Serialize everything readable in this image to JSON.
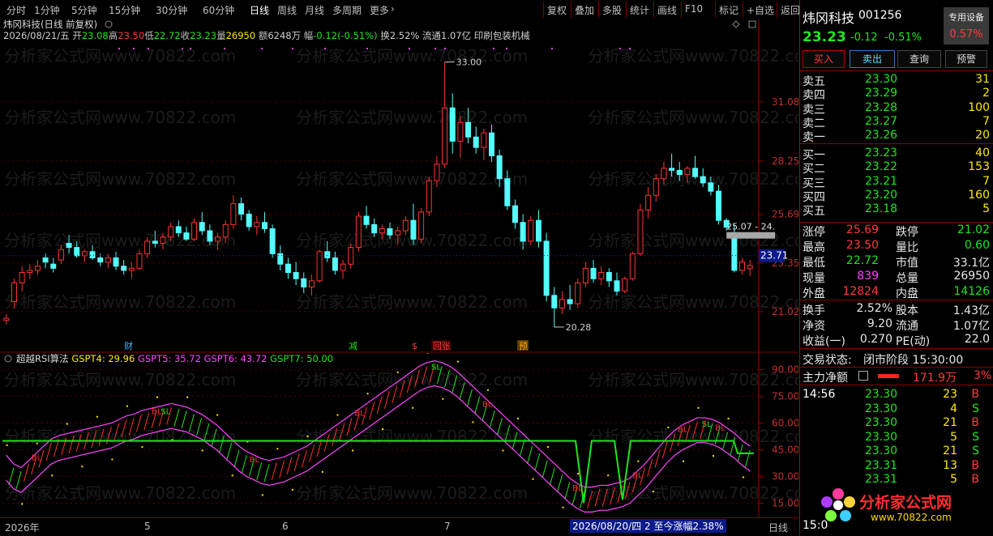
{
  "toolbar": {
    "periods": [
      "分时",
      "1分钟",
      "5分钟",
      "15分钟",
      "30分钟",
      "60分钟",
      "日线",
      "周线",
      "月线",
      "多周期",
      "更多"
    ],
    "active_period": "日线",
    "more_chevron": "›",
    "actions": [
      "复权",
      "叠加",
      "多股",
      "统计",
      "画线",
      "F10",
      "标记",
      "+自选",
      "返回"
    ]
  },
  "info_line": {
    "date": "2026/08/21/五",
    "open_label": "开",
    "open": "23.08",
    "high_label": "高",
    "high": "23.50",
    "low_label": "低",
    "low": "22.72",
    "close_label": "收",
    "close": "23.23",
    "vol_label": "量",
    "vol": "26950",
    "amt_label": "额",
    "amt": "6248万",
    "chg_label": "幅",
    "chg": "-0.12(-0.51%)",
    "turnover": "换2.52%",
    "float": "流通1.07亿",
    "industry": "印刷包装机械"
  },
  "chart_title": "炜冈科技(日线 前复权)",
  "watermark": "分析家公式网www.70822.com",
  "chart_data": [
    {
      "type": "candlestick",
      "y_ticks": [
        "31.08",
        "28.25",
        "25.69",
        "23.35",
        "21.02"
      ],
      "ylim": [
        19.5,
        34.5
      ],
      "current_price_label": "23.71",
      "peak_label": "33.00",
      "trough_label": "20.28",
      "range_label": "25.07 - 24.",
      "event_markers": [
        "财",
        "减",
        "$",
        "回张",
        "预"
      ],
      "candles": [
        [
          20.6,
          20.9,
          20.4,
          20.7
        ],
        [
          21.5,
          22.6,
          21.2,
          22.4
        ],
        [
          22.4,
          23.2,
          22.0,
          22.9
        ],
        [
          22.9,
          23.3,
          22.6,
          23.0
        ],
        [
          23.0,
          23.5,
          22.8,
          23.2
        ],
        [
          23.6,
          23.8,
          23.1,
          23.4
        ],
        [
          23.3,
          23.6,
          22.9,
          23.1
        ],
        [
          23.5,
          24.2,
          23.3,
          24.0
        ],
        [
          24.3,
          24.7,
          23.8,
          24.1
        ],
        [
          24.1,
          24.4,
          23.6,
          23.7
        ],
        [
          23.7,
          24.0,
          23.4,
          23.9
        ],
        [
          23.9,
          24.2,
          23.5,
          23.6
        ],
        [
          23.6,
          23.8,
          23.2,
          23.4
        ],
        [
          23.4,
          23.8,
          23.1,
          23.6
        ],
        [
          23.6,
          23.9,
          23.0,
          23.2
        ],
        [
          23.2,
          23.5,
          22.8,
          23.0
        ],
        [
          23.0,
          23.4,
          22.6,
          23.1
        ],
        [
          23.1,
          24.0,
          23.0,
          23.8
        ],
        [
          23.8,
          24.6,
          23.6,
          24.4
        ],
        [
          24.4,
          24.9,
          24.1,
          24.3
        ],
        [
          24.3,
          24.8,
          24.0,
          24.6
        ],
        [
          24.6,
          25.3,
          24.4,
          25.1
        ],
        [
          25.1,
          25.4,
          24.6,
          24.8
        ],
        [
          24.8,
          25.1,
          24.4,
          24.5
        ],
        [
          24.5,
          25.5,
          24.4,
          25.3
        ],
        [
          25.3,
          25.8,
          24.7,
          24.9
        ],
        [
          24.9,
          25.2,
          24.2,
          24.4
        ],
        [
          24.4,
          24.8,
          24.0,
          24.6
        ],
        [
          24.6,
          25.4,
          24.3,
          25.2
        ],
        [
          25.2,
          26.6,
          25.0,
          26.2
        ],
        [
          26.2,
          26.5,
          25.4,
          25.7
        ],
        [
          25.7,
          25.9,
          24.9,
          25.1
        ],
        [
          25.1,
          25.6,
          24.7,
          25.3
        ],
        [
          25.3,
          25.8,
          24.8,
          25.0
        ],
        [
          25.0,
          25.2,
          23.6,
          23.8
        ],
        [
          23.8,
          24.2,
          23.0,
          23.3
        ],
        [
          23.3,
          23.6,
          22.6,
          22.9
        ],
        [
          22.9,
          23.4,
          22.3,
          22.6
        ],
        [
          22.6,
          22.9,
          21.9,
          22.2
        ],
        [
          22.2,
          22.8,
          21.8,
          22.5
        ],
        [
          22.5,
          24.0,
          22.4,
          23.9
        ],
        [
          23.9,
          24.4,
          23.4,
          23.6
        ],
        [
          23.6,
          23.9,
          22.8,
          23.0
        ],
        [
          23.0,
          23.5,
          22.6,
          23.3
        ],
        [
          23.3,
          24.3,
          23.1,
          24.1
        ],
        [
          24.1,
          25.8,
          23.9,
          25.6
        ],
        [
          25.6,
          26.1,
          25.0,
          25.2
        ],
        [
          25.2,
          25.5,
          24.6,
          24.8
        ],
        [
          24.8,
          25.2,
          24.5,
          25.0
        ],
        [
          25.0,
          25.3,
          24.5,
          24.7
        ],
        [
          24.7,
          25.1,
          24.3,
          24.9
        ],
        [
          24.9,
          25.6,
          24.7,
          25.4
        ],
        [
          25.4,
          26.2,
          24.2,
          24.5
        ],
        [
          24.5,
          26.0,
          24.3,
          25.8
        ],
        [
          25.8,
          27.5,
          25.6,
          27.3
        ],
        [
          27.3,
          28.5,
          27.0,
          28.1
        ],
        [
          28.1,
          33.0,
          27.9,
          30.8
        ],
        [
          30.8,
          31.5,
          28.6,
          29.2
        ],
        [
          29.2,
          30.4,
          28.4,
          30.1
        ],
        [
          30.1,
          30.8,
          29.1,
          29.4
        ],
        [
          29.4,
          29.9,
          28.6,
          28.9
        ],
        [
          28.9,
          29.8,
          28.3,
          29.6
        ],
        [
          29.6,
          30.0,
          28.2,
          28.5
        ],
        [
          28.5,
          28.8,
          27.0,
          27.4
        ],
        [
          27.4,
          27.8,
          25.9,
          26.1
        ],
        [
          26.1,
          26.4,
          25.0,
          25.3
        ],
        [
          25.3,
          25.7,
          24.0,
          24.4
        ],
        [
          24.4,
          25.6,
          24.2,
          25.4
        ],
        [
          25.4,
          25.9,
          24.1,
          24.4
        ],
        [
          24.4,
          24.8,
          21.5,
          21.8
        ],
        [
          21.8,
          22.2,
          20.28,
          21.2
        ],
        [
          21.2,
          22.0,
          20.9,
          21.6
        ],
        [
          21.6,
          22.3,
          21.1,
          21.4
        ],
        [
          21.4,
          22.6,
          21.2,
          22.4
        ],
        [
          22.4,
          23.4,
          22.2,
          23.1
        ],
        [
          23.1,
          23.5,
          22.4,
          22.6
        ],
        [
          22.6,
          23.2,
          22.3,
          22.9
        ],
        [
          22.9,
          23.1,
          22.2,
          22.5
        ],
        [
          22.5,
          22.9,
          21.8,
          22.0
        ],
        [
          22.0,
          22.7,
          21.9,
          22.6
        ],
        [
          22.6,
          23.9,
          22.5,
          23.8
        ],
        [
          23.8,
          26.2,
          23.7,
          25.9
        ],
        [
          25.9,
          27.0,
          25.5,
          26.6
        ],
        [
          26.6,
          27.6,
          26.3,
          27.4
        ],
        [
          27.4,
          28.2,
          27.1,
          27.9
        ],
        [
          27.9,
          28.6,
          27.5,
          27.8
        ],
        [
          27.8,
          28.2,
          27.3,
          27.6
        ],
        [
          27.6,
          28.0,
          27.2,
          27.9
        ],
        [
          27.9,
          28.5,
          27.4,
          27.5
        ],
        [
          27.5,
          27.9,
          27.0,
          27.2
        ],
        [
          27.2,
          27.5,
          26.6,
          26.8
        ],
        [
          26.8,
          27.1,
          25.2,
          25.4
        ],
        [
          25.4,
          25.5,
          24.9,
          25.07
        ],
        [
          24.8,
          25.2,
          22.9,
          23.0
        ],
        [
          23.0,
          23.6,
          22.8,
          23.4
        ],
        [
          23.08,
          23.5,
          22.72,
          23.23
        ]
      ]
    },
    {
      "type": "line",
      "title": "超越RSI算法",
      "series": [
        {
          "name": "GSPT4",
          "value": "29.96",
          "color": "#ffea00"
        },
        {
          "name": "GSPT5",
          "value": "35.72",
          "color": "#ff44ff"
        },
        {
          "name": "GSPT6",
          "value": "43.72",
          "color": "#ff44ff"
        },
        {
          "name": "GSPT7",
          "value": "50.00",
          "color": "#1ee61e"
        }
      ],
      "y_ticks": [
        "90.00",
        "75.00",
        "60.00",
        "45.00",
        "30.00",
        "15.00"
      ],
      "ylim": [
        12,
        93
      ],
      "line_value": [
        35,
        30,
        28,
        32,
        36,
        40,
        44,
        46,
        47,
        48,
        49,
        50,
        51,
        52,
        53,
        55,
        57,
        58,
        60,
        61,
        62,
        63,
        64,
        63,
        62,
        60,
        58,
        55,
        52,
        48,
        44,
        40,
        37,
        35,
        33,
        32,
        33,
        34,
        36,
        38,
        40,
        43,
        46,
        49,
        52,
        55,
        58,
        61,
        64,
        67,
        70,
        73,
        76,
        79,
        82,
        85,
        87,
        88,
        87,
        85,
        82,
        78,
        74,
        70,
        66,
        62,
        58,
        54,
        50,
        46,
        42,
        38,
        34,
        30,
        26,
        22,
        19,
        17,
        17,
        18,
        18,
        19,
        20,
        22,
        26,
        30,
        35,
        40,
        45,
        49,
        52,
        54,
        56,
        56,
        55,
        53,
        50,
        47,
        43,
        40
      ],
      "band_offset": 7,
      "buy_signals": [
        "BL",
        "BL",
        "BL",
        "BL",
        "BL",
        "BL",
        "BL",
        "BL",
        "BL"
      ],
      "sell_signals": [
        "SL",
        "SL",
        "SL"
      ]
    }
  ],
  "status": {
    "year": "2026年",
    "months": [
      "5",
      "6",
      "7"
    ],
    "range_text": "2026/08/20/四 2 至今涨幅2.38%",
    "period": "日线"
  },
  "right": {
    "name": "炜冈科技",
    "code": "001256",
    "device_btn": "专用设备",
    "device_pct": "0.57%",
    "price": "23.23",
    "change": "-0.12",
    "change_pct": "-0.51%",
    "buttons": [
      "买入",
      "卖出",
      "查询",
      "预警"
    ],
    "asks": [
      {
        "label": "卖五",
        "price": "23.30",
        "vol": "31"
      },
      {
        "label": "卖四",
        "price": "23.29",
        "vol": "2"
      },
      {
        "label": "卖三",
        "price": "23.28",
        "vol": "100"
      },
      {
        "label": "卖二",
        "price": "23.27",
        "vol": "7"
      },
      {
        "label": "卖一",
        "price": "23.26",
        "vol": "20"
      }
    ],
    "bids": [
      {
        "label": "买一",
        "price": "23.23",
        "vol": "40"
      },
      {
        "label": "买二",
        "price": "23.22",
        "vol": "153"
      },
      {
        "label": "买三",
        "price": "23.21",
        "vol": "7"
      },
      {
        "label": "买四",
        "price": "23.20",
        "vol": "160"
      },
      {
        "label": "买五",
        "price": "23.18",
        "vol": "5"
      }
    ],
    "stats": [
      {
        "l1": "涨停",
        "v1": "25.69",
        "c1": "red",
        "l2": "跌停",
        "v2": "21.02",
        "c2": "green"
      },
      {
        "l1": "最高",
        "v1": "23.50",
        "c1": "red",
        "l2": "量比",
        "v2": "0.60",
        "c2": "green"
      },
      {
        "l1": "最低",
        "v1": "22.72",
        "c1": "green",
        "l2": "市值",
        "v2": "33.1亿",
        "c2": "white"
      },
      {
        "l1": "现量",
        "v1": "839",
        "c1": "magenta",
        "l2": "总量",
        "v2": "26950",
        "c2": "white"
      },
      {
        "l1": "外盘",
        "v1": "12824",
        "c1": "red",
        "l2": "内盘",
        "v2": "14126",
        "c2": "green"
      }
    ],
    "stats2": [
      {
        "l1": "换手",
        "v1": "2.52%",
        "l2": "股本",
        "v2": "1.43亿"
      },
      {
        "l1": "净资",
        "v1": "9.20",
        "l2": "流通",
        "v2": "1.07亿"
      },
      {
        "l1": "收益(一)",
        "v1": "0.270",
        "l2": "PE(动)",
        "v2": "22.0"
      }
    ],
    "trade_state_label": "交易状态:",
    "trade_state": "闭市阶段 15:30:00",
    "main_flow_label": "主力净额",
    "main_flow": "171.9万",
    "main_flow_pct": "3%",
    "ticks": [
      {
        "time": "14:56",
        "price": "23.30",
        "vol": "23",
        "side": "B"
      },
      {
        "time": "",
        "price": "23.30",
        "vol": "4",
        "side": "S"
      },
      {
        "time": "",
        "price": "23.30",
        "vol": "21",
        "side": "B"
      },
      {
        "time": "",
        "price": "23.30",
        "vol": "5",
        "side": "S"
      },
      {
        "time": "",
        "price": "23.30",
        "vol": "21",
        "side": "S"
      },
      {
        "time": "",
        "price": "23.31",
        "vol": "13",
        "side": "B"
      },
      {
        "time": "",
        "price": "23.31",
        "vol": "5",
        "side": "B"
      }
    ],
    "logo_text": "分析家公式网",
    "logo_url": "www.70822.com",
    "bottom_time": "15:0"
  }
}
